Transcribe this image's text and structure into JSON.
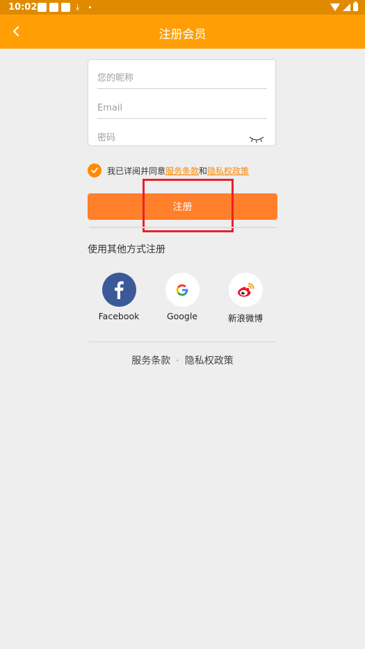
{
  "status_bar": {
    "time": "10:02"
  },
  "app_bar": {
    "title": "注册会员",
    "icon": "back-arrow-icon"
  },
  "form": {
    "nickname_placeholder": "您的昵称",
    "email_placeholder": "Email",
    "password_placeholder": "密码",
    "password_toggle_icon": "eye-closed-icon"
  },
  "agreement": {
    "checked": true,
    "prefix": "我已详阅并同意",
    "terms_link": "服务条款",
    "conjunction": "和",
    "privacy_link": "隐私权政策"
  },
  "register_button": {
    "label": "注册"
  },
  "other_methods": {
    "title": "使用其他方式注册",
    "options": [
      {
        "label": "Facebook",
        "icon": "facebook-icon",
        "color": "#3b5998"
      },
      {
        "label": "Google",
        "icon": "google-icon"
      },
      {
        "label": "新浪微博",
        "icon": "weibo-icon",
        "color": "#e6162d"
      }
    ]
  },
  "footer": {
    "terms": "服务条款",
    "separator": "·",
    "privacy": "隐私权政策"
  },
  "colors": {
    "primary": "#ff9f05",
    "button": "#ff7f2a",
    "status_bar": "#e08a00",
    "highlight": "#e8212a"
  }
}
